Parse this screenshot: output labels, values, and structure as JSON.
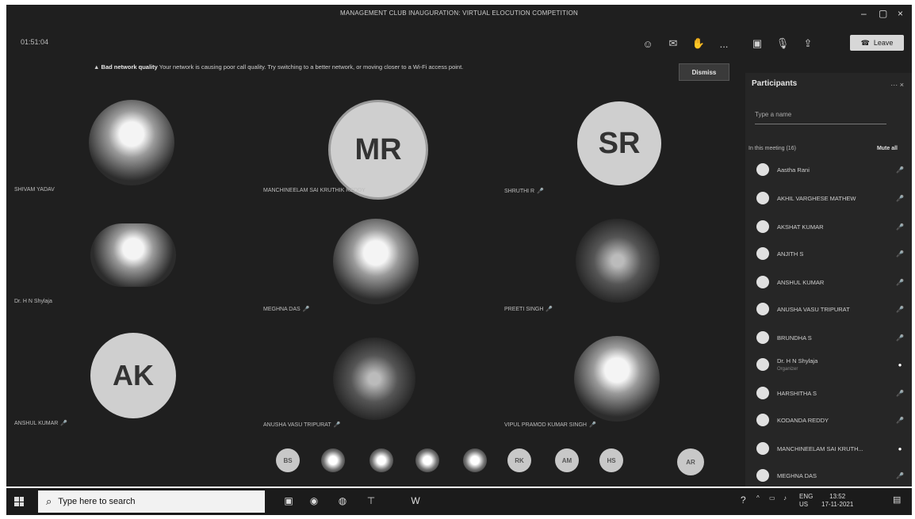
{
  "window": {
    "title": "MANAGEMENT CLUB INAUGURATION: VIRTUAL ELOCUTION COMPETITION",
    "timer": "01:51:04"
  },
  "toolbar": {
    "leave_label": "Leave",
    "more_label": "..."
  },
  "banner": {
    "heading": "Bad network quality",
    "message": "Your network is causing poor call quality. Try switching to a better network, or moving closer to a Wi-Fi access point.",
    "dismiss_label": "Dismiss"
  },
  "tiles": [
    {
      "name": "SHIVAM YADAV",
      "initials": "",
      "photo": true
    },
    {
      "name": "MANCHINEELAM SAI KRUTHIK REDDY",
      "initials": "MR",
      "photo": false
    },
    {
      "name": "SHRUTHI R",
      "initials": "SR",
      "photo": false
    },
    {
      "name": "Dr. H N Shylaja",
      "initials": "",
      "photo": true
    },
    {
      "name": "MEGHNA DAS",
      "initials": "",
      "photo": true
    },
    {
      "name": "PREETI SINGH",
      "initials": "",
      "photo": true
    },
    {
      "name": "ANSHUL KUMAR",
      "initials": "AK",
      "photo": false
    },
    {
      "name": "ANUSHA VASU TRIPURAT",
      "initials": "",
      "photo": true
    },
    {
      "name": "VIPUL PRAMOD KUMAR SINGH",
      "initials": "",
      "photo": true
    }
  ],
  "strip": [
    "BS",
    "",
    "",
    "",
    "",
    "RK",
    "AM",
    "HS",
    "AR"
  ],
  "participants": {
    "title": "Participants",
    "search_placeholder": "Type a name",
    "in_meeting": "In this meeting (16)",
    "mute_all": "Mute all",
    "people": [
      {
        "name": "Aastha Rani",
        "sub": ""
      },
      {
        "name": "AKHIL VARGHESE MATHEW",
        "sub": ""
      },
      {
        "name": "AKSHAT KUMAR",
        "sub": ""
      },
      {
        "name": "ANJITH S",
        "sub": ""
      },
      {
        "name": "ANSHUL KUMAR",
        "sub": ""
      },
      {
        "name": "ANUSHA VASU TRIPURAT",
        "sub": ""
      },
      {
        "name": "BRUNDHA S",
        "sub": ""
      },
      {
        "name": "Dr. H N Shylaja",
        "sub": "Organizer"
      },
      {
        "name": "HARSHITHA S",
        "sub": ""
      },
      {
        "name": "KODANDA REDDY",
        "sub": ""
      },
      {
        "name": "MANCHINEELAM SAI KRUTH...",
        "sub": ""
      },
      {
        "name": "MEGHNA DAS",
        "sub": ""
      }
    ]
  },
  "taskbar": {
    "search_placeholder": "Type here to search",
    "lang": "ENG",
    "region": "US",
    "time": "13:52",
    "date": "17-11-2021"
  }
}
